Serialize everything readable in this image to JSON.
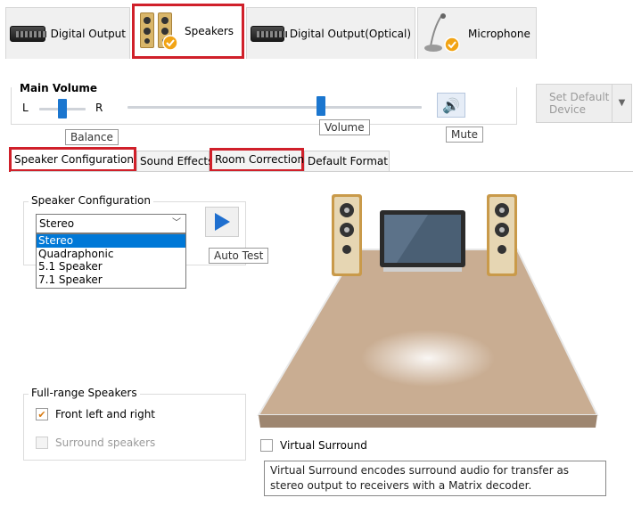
{
  "device_tabs": [
    {
      "label": "Digital Output",
      "icon": "digital-output-device-icon"
    },
    {
      "label": "Speakers",
      "icon": "speakers-icon",
      "active": true
    },
    {
      "label": "Digital Output(Optical)",
      "icon": "optical-output-device-icon"
    },
    {
      "label": "Microphone",
      "icon": "microphone-icon"
    }
  ],
  "main_volume": {
    "title": "Main Volume",
    "left_label": "L",
    "right_label": "R",
    "balance_tooltip": "Balance",
    "volume_tooltip": "Volume",
    "mute_tooltip": "Mute",
    "balance_position": 0.5,
    "volume_position": 0.66
  },
  "set_default": {
    "line1": "Set Default",
    "line2": "Device"
  },
  "sub_tabs": [
    {
      "label": "Speaker Configuration",
      "active": true
    },
    {
      "label": "Sound Effects"
    },
    {
      "label": "Room Correction",
      "highlighted": true
    },
    {
      "label": "Default Format"
    }
  ],
  "speaker_config": {
    "group_title": "Speaker Configuration",
    "selected": "Stereo",
    "options": [
      "Stereo",
      "Quadraphonic",
      "5.1 Speaker",
      "7.1 Speaker"
    ],
    "auto_test_tooltip": "Auto Test"
  },
  "full_range": {
    "group_title": "Full-range Speakers",
    "front": {
      "label": "Front left and right",
      "checked": true
    },
    "surround": {
      "label": "Surround speakers",
      "checked": false,
      "disabled": true
    }
  },
  "virtual_surround": {
    "label": "Virtual Surround",
    "checked": false,
    "tooltip": "Virtual Surround encodes surround audio for transfer as stereo output to receivers with a Matrix decoder."
  },
  "colors": {
    "highlight": "#d0202a",
    "accent": "#1b76cf",
    "selection": "#0078d7",
    "check": "#d87a12",
    "floor": "#c4a98e"
  }
}
